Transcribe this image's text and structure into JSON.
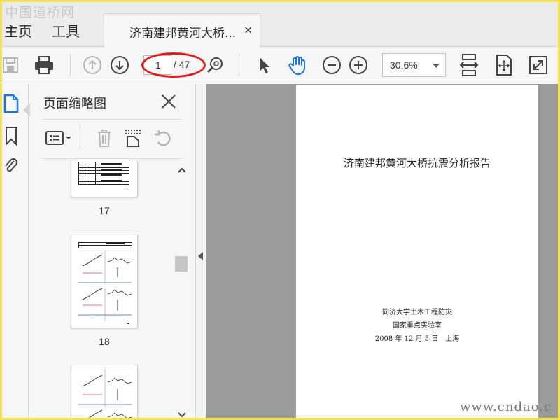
{
  "watermarks": {
    "top": "中国道桥网",
    "bottom": "www.cndao.c"
  },
  "nav": {
    "home": "主页",
    "tools": "工具"
  },
  "tab": {
    "title": "济南建邦黄河大桥...",
    "close": "×"
  },
  "toolbar": {
    "current_page": "1",
    "total_pages": "/ 47",
    "zoom": "30.6%",
    "icons": [
      "save-icon",
      "print-icon",
      "previous-page-icon",
      "next-page-icon",
      "zoom-find-icon",
      "select-cursor-icon",
      "hand-tool-icon",
      "zoom-out-icon",
      "zoom-in-icon",
      "fit-width-icon",
      "fit-page-icon",
      "full-screen-icon"
    ],
    "accent": "#1a73d9",
    "highlight": "#e21b1b"
  },
  "sidebar_panel": {
    "title": "页面缩略图",
    "thumbnails": [
      {
        "label": "17"
      },
      {
        "label": "18"
      }
    ]
  },
  "document": {
    "title": "济南建邦黄河大桥抗震分析报告",
    "org_line1": "同济大学土木工程防灾",
    "org_line2": "国家重点实验室",
    "date_line": "2008 年 12 月 5 日　上海"
  }
}
